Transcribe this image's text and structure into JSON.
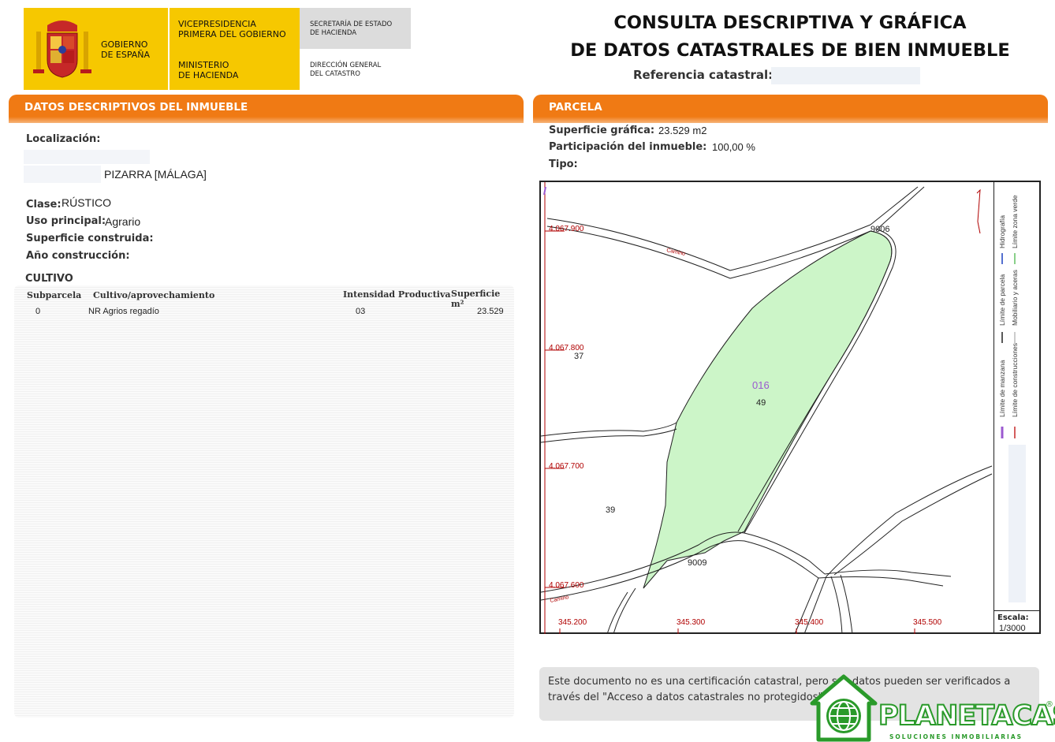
{
  "header": {
    "logo_gobierno": [
      "GOBIERNO",
      "DE ESPAÑA"
    ],
    "logo_vicepresidencia": [
      "VICEPRESIDENCIA",
      "PRIMERA DEL GOBIERNO"
    ],
    "logo_ministerio": [
      "MINISTERIO",
      "DE HACIENDA"
    ],
    "logo_secretaria": [
      "SECRETARÍA DE ESTADO",
      "DE HACIENDA"
    ],
    "logo_direccion": [
      "DIRECCIÓN GENERAL",
      "DEL CATASTRO"
    ],
    "title_line1": "CONSULTA DESCRIPTIVA Y GRÁFICA",
    "title_line2": "DE DATOS CATASTRALES DE BIEN INMUEBLE",
    "ref_label": "Referencia catastral:"
  },
  "left": {
    "section_title": "DATOS DESCRIPTIVOS DEL INMUEBLE",
    "localizacion_label": "Localización:",
    "localizacion_value": "PIZARRA [MÁLAGA]",
    "clase_label": "Clase:",
    "clase_value": "RÚSTICO",
    "uso_label": "Uso principal:",
    "uso_value": "Agrario",
    "superficie_construida_label": "Superficie construida:",
    "anio_label": "Año construcción:",
    "cultivo_title": "CULTIVO",
    "cultivo_headers": [
      "Subparcela",
      "Cultivo/aprovechamiento",
      "Intensidad Productiva",
      "Superficie m²"
    ],
    "cultivo_rows": [
      [
        "0",
        "NR Agrios regadío",
        "03",
        "23.529"
      ]
    ]
  },
  "right": {
    "section_title": "PARCELA",
    "superficie_label": "Superficie gráfica:",
    "superficie_value": "23.529 m2",
    "participacion_label": "Participación del inmueble:",
    "participacion_value": "100,00 %",
    "tipo_label": "Tipo:",
    "map": {
      "y_coords": [
        "4.067.900",
        "4.067.800",
        "4.067.700",
        "4.067.600"
      ],
      "x_coords": [
        "345.200",
        "345.300",
        "345.400",
        "345.500"
      ],
      "parcel_id": "016",
      "parcel_number": "49",
      "labels": [
        "9006",
        "37",
        "39",
        "9009"
      ],
      "road_label": "Camino",
      "parcel_fill": "#ccf5c8",
      "grid_color": "#b00000",
      "legend": [
        "Límite de manzana",
        "Límite de parcela",
        "Hidrografía",
        "Límite de construcciones",
        "Mobiliario y aceras",
        "Límite zona verde"
      ],
      "scale_label": "Escala:",
      "scale_value": "1/3000"
    },
    "notice": "Este documento no es una certificación catastral, pero sus datos pueden ser verificados a través del \"Acceso a datos catastrales no protegidos\""
  },
  "watermark": {
    "brand": "PLANETACASA",
    "tagline": "SOLUCIONES INMOBILIARIAS",
    "registered": "®",
    "color": "#2a9a2a"
  }
}
